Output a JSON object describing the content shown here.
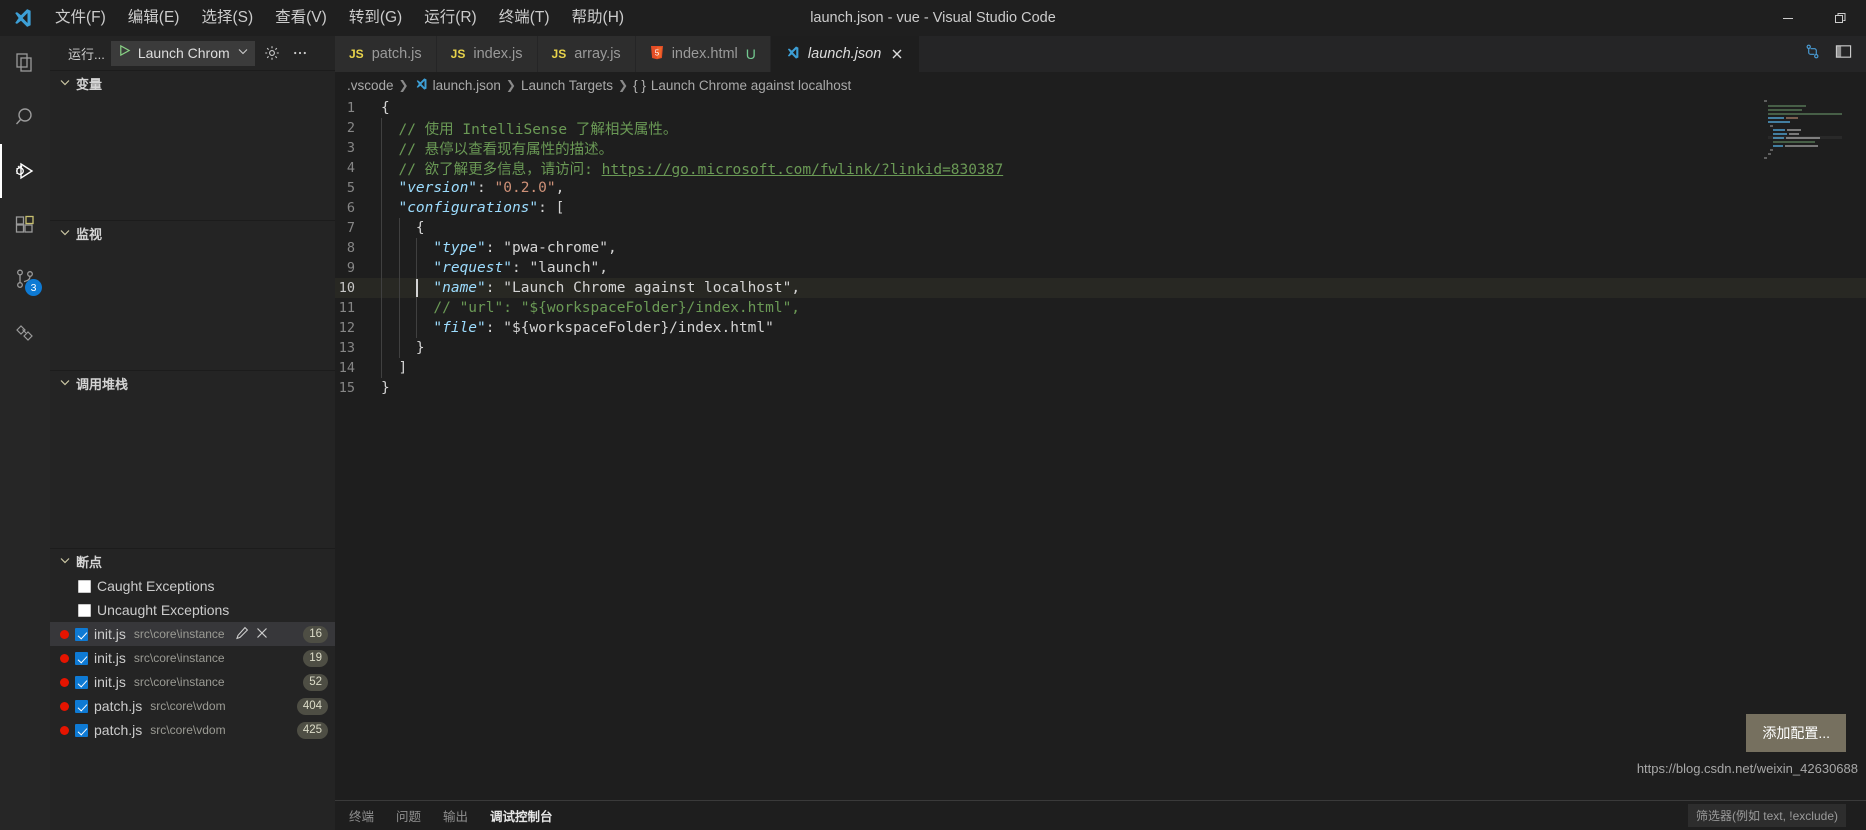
{
  "window": {
    "title": "launch.json - vue - Visual Studio Code",
    "logo": "vscode-logo",
    "controls": [
      {
        "name": "minimize-button",
        "glyph": "—"
      },
      {
        "name": "maximize-button",
        "glyph": "❐"
      }
    ]
  },
  "menubar": {
    "items": [
      {
        "label": "文件(F)",
        "name": "menu-file"
      },
      {
        "label": "编辑(E)",
        "name": "menu-edit"
      },
      {
        "label": "选择(S)",
        "name": "menu-selection"
      },
      {
        "label": "查看(V)",
        "name": "menu-view"
      },
      {
        "label": "转到(G)",
        "name": "menu-go"
      },
      {
        "label": "运行(R)",
        "name": "menu-run"
      },
      {
        "label": "终端(T)",
        "name": "menu-terminal"
      },
      {
        "label": "帮助(H)",
        "name": "menu-help"
      }
    ]
  },
  "activitybar": {
    "items": [
      {
        "name": "explorer-icon",
        "label": "Explorer",
        "active": false,
        "badge": ""
      },
      {
        "name": "search-icon",
        "label": "Search",
        "active": false,
        "badge": ""
      },
      {
        "name": "run-and-debug-icon",
        "label": "Run and Debug",
        "active": true,
        "badge": ""
      },
      {
        "name": "extensions-icon",
        "label": "Extensions",
        "active": false,
        "badge": ""
      },
      {
        "name": "source-control-icon",
        "label": "Source Control",
        "active": false,
        "badge": "3"
      },
      {
        "name": "testing-icon",
        "label": "Testing",
        "active": false,
        "badge": ""
      }
    ]
  },
  "sidebar": {
    "toolbar": {
      "run_label": "运行...",
      "config_name": "Launch Chrom",
      "play_icon": "play-icon",
      "chevron_icon": "chevron-down-icon",
      "gear_icon": "gear-icon",
      "more_icon": "more-actions-icon"
    },
    "sections": [
      {
        "name": "variables",
        "title": "变量"
      },
      {
        "name": "watch",
        "title": "监视"
      },
      {
        "name": "call-stack",
        "title": "调用堆栈"
      },
      {
        "name": "breakpoints",
        "title": "断点"
      }
    ],
    "breakpoints": {
      "exceptions": [
        {
          "label": "Caught Exceptions",
          "checked": false
        },
        {
          "label": "Uncaught Exceptions",
          "checked": false
        }
      ],
      "items": [
        {
          "file": "init.js",
          "path": "src\\core\\instance",
          "line": "16",
          "checked": true,
          "selected": true
        },
        {
          "file": "init.js",
          "path": "src\\core\\instance",
          "line": "19",
          "checked": true,
          "selected": false
        },
        {
          "file": "init.js",
          "path": "src\\core\\instance",
          "line": "52",
          "checked": true,
          "selected": false
        },
        {
          "file": "patch.js",
          "path": "src\\core\\vdom",
          "line": "404",
          "checked": true,
          "selected": false
        },
        {
          "file": "patch.js",
          "path": "src\\core\\vdom",
          "line": "425",
          "checked": true,
          "selected": false
        }
      ]
    }
  },
  "editor": {
    "tabs": [
      {
        "label": "patch.js",
        "icon": "JS",
        "icon_kind": "js",
        "active": false,
        "dirty": "",
        "closable": false
      },
      {
        "label": "index.js",
        "icon": "JS",
        "icon_kind": "js",
        "active": false,
        "dirty": "",
        "closable": false
      },
      {
        "label": "array.js",
        "icon": "JS",
        "icon_kind": "js",
        "active": false,
        "dirty": "",
        "closable": false
      },
      {
        "label": "index.html",
        "icon": "5",
        "icon_kind": "html",
        "active": false,
        "dirty": "U",
        "closable": false
      },
      {
        "label": "launch.json",
        "icon": "VS",
        "icon_kind": "json",
        "active": true,
        "dirty": "",
        "closable": true
      }
    ],
    "tab_actions": [
      {
        "name": "split-editor-icon"
      },
      {
        "name": "toggle-panel-icon"
      }
    ],
    "breadcrumb": [
      {
        "label": ".vscode",
        "icon": ""
      },
      {
        "label": "launch.json",
        "icon": "vscode-json-icon"
      },
      {
        "label": "Launch Targets",
        "icon": ""
      },
      {
        "label": "Launch Chrome against localhost",
        "icon": "{}"
      }
    ],
    "lines": [
      {
        "n": "1",
        "html": "<span class=\"tok-brace\">{</span>",
        "indent": 0,
        "current": false
      },
      {
        "n": "2",
        "html": "<span class=\"tok-com\">  // 使用 IntelliSense 了解相关属性。</span>",
        "indent": 1,
        "current": false
      },
      {
        "n": "3",
        "html": "<span class=\"tok-com\">  // 悬停以查看现有属性的描述。</span>",
        "indent": 1,
        "current": false
      },
      {
        "n": "4",
        "html": "<span class=\"tok-com\">  // 欲了解更多信息，请访问: </span><span class=\"tok-link\">https://go.microsoft.com/fwlink/?linkid=830387</span>",
        "indent": 1,
        "current": false
      },
      {
        "n": "5",
        "html": "  <span class=\"tok-key\">\"version\"</span><span class=\"tok-punc\">: </span><span class=\"tok-str\">\"0.2.0\"</span><span class=\"tok-punc\">,</span>",
        "indent": 1,
        "current": false
      },
      {
        "n": "6",
        "html": "  <span class=\"tok-key\">\"configurations\"</span><span class=\"tok-punc\">: [</span>",
        "indent": 1,
        "current": false
      },
      {
        "n": "7",
        "html": "    <span class=\"tok-brace\">{</span>",
        "indent": 2,
        "current": false
      },
      {
        "n": "8",
        "html": "      <span class=\"tok-key\">\"type\"</span><span class=\"tok-punc\">: </span><span class=\"tok-str2\">\"pwa-chrome\"</span><span class=\"tok-punc\">,</span>",
        "indent": 3,
        "current": false
      },
      {
        "n": "9",
        "html": "      <span class=\"tok-key\">\"request\"</span><span class=\"tok-punc\">: </span><span class=\"tok-str2\">\"launch\"</span><span class=\"tok-punc\">,</span>",
        "indent": 3,
        "current": false
      },
      {
        "n": "10",
        "html": "      <span class=\"tok-key\">\"name\"</span><span class=\"tok-punc\">: </span><span class=\"tok-str2\">\"Launch Chrome against localhost\"</span><span class=\"tok-punc\">,</span>",
        "indent": 3,
        "current": true
      },
      {
        "n": "11",
        "html": "      <span class=\"tok-com\">// \"url\": \"${workspaceFolder}/index.html\",</span>",
        "indent": 3,
        "current": false
      },
      {
        "n": "12",
        "html": "      <span class=\"tok-key\">\"file\"</span><span class=\"tok-punc\">: </span><span class=\"tok-str2\">\"${workspaceFolder}/index.html\"</span>",
        "indent": 3,
        "current": false
      },
      {
        "n": "13",
        "html": "    <span class=\"tok-brace\">}</span>",
        "indent": 2,
        "current": false
      },
      {
        "n": "14",
        "html": "  <span class=\"tok-punc\">]</span>",
        "indent": 1,
        "current": false
      },
      {
        "n": "15",
        "html": "<span class=\"tok-brace\">}</span>",
        "indent": 0,
        "current": false
      }
    ],
    "add_config_label": "添加配置...",
    "watermark": "https://blog.csdn.net/weixin_42630688"
  },
  "panel": {
    "tabs": [
      {
        "label": "终端",
        "active": false
      },
      {
        "label": "问题",
        "active": false
      },
      {
        "label": "输出",
        "active": false
      },
      {
        "label": "调试控制台",
        "active": true
      }
    ],
    "filter_label": "筛选器(例如 text, !exclude)"
  },
  "colors": {
    "accent": "#0e7ad4",
    "breakpoint_red": "#e51400",
    "button_bg": "#76705f",
    "editor_bg": "#1e1e1e",
    "sidebar_bg": "#242424"
  }
}
